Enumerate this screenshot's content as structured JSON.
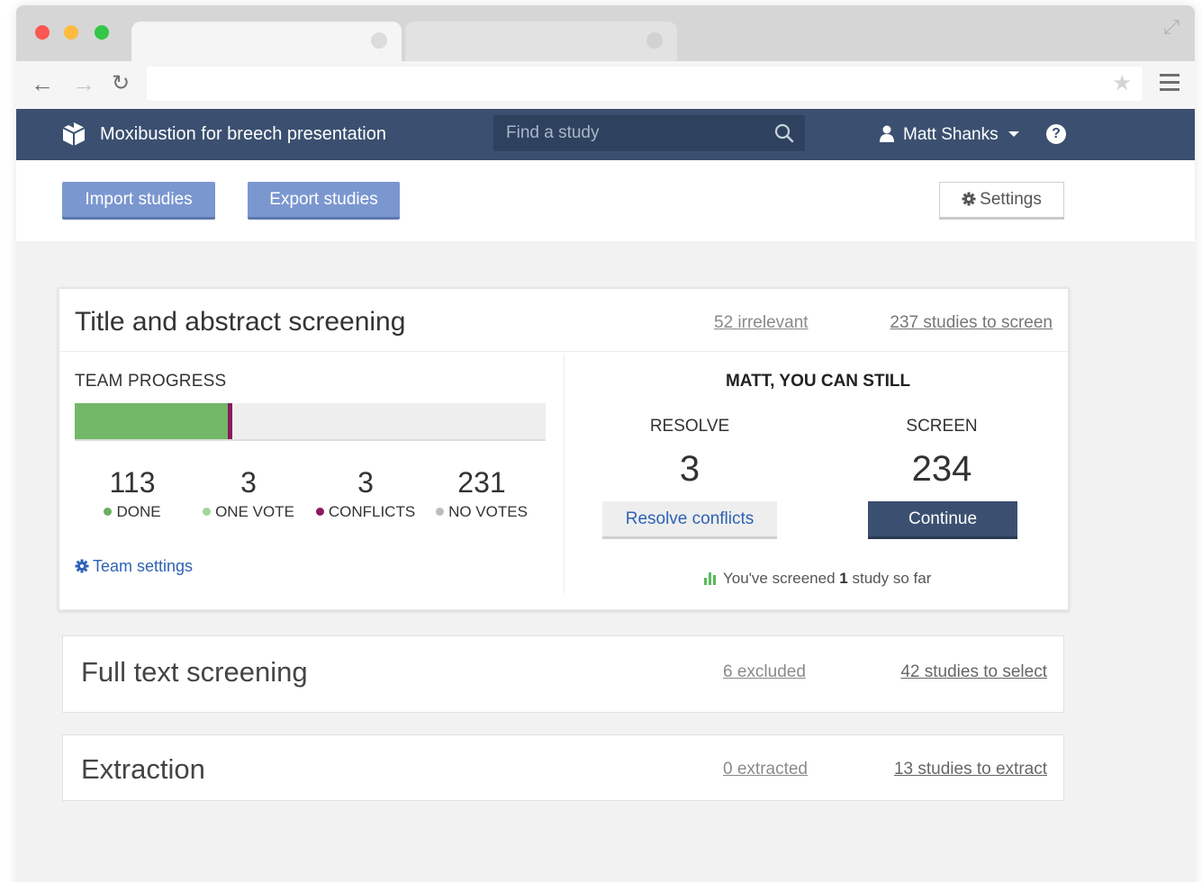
{
  "browser": {
    "address_value": ""
  },
  "app": {
    "project_title": "Moxibustion for breech presentation",
    "search_placeholder": "Find a study",
    "user_name": "Matt Shanks",
    "help_label": "?"
  },
  "actions": {
    "import_label": "Import studies",
    "export_label": "Export studies",
    "settings_label": "Settings"
  },
  "title_abstract": {
    "title": "Title and abstract screening",
    "irrelevant_link": "52 irrelevant",
    "to_screen_link": "237 studies to screen",
    "team_progress_label": "TEAM PROGRESS",
    "progress": {
      "done_fraction": 0.3256,
      "conflicts_fraction": 0.0086,
      "done_color": "#73b769",
      "conflict_color": "#8b1a5e"
    },
    "stats": [
      {
        "value": "113",
        "label": "DONE",
        "color": "#6aaf5e"
      },
      {
        "value": "3",
        "label": "ONE VOTE",
        "color": "#a6d49b"
      },
      {
        "value": "3",
        "label": "CONFLICTS",
        "color": "#8b1a5e"
      },
      {
        "value": "231",
        "label": "NO VOTES",
        "color": "#bdbdbd"
      }
    ],
    "team_settings_label": "Team settings",
    "you_can_still": "MATT, YOU CAN STILL",
    "resolve_label": "RESOLVE",
    "resolve_count": "3",
    "screen_label": "SCREEN",
    "screen_count": "234",
    "resolve_button": "Resolve conflicts",
    "continue_button": "Continue",
    "screened_prefix": "You've screened",
    "screened_count": "1",
    "screened_suffix": "study so far"
  },
  "full_text": {
    "title": "Full text screening",
    "excluded_link": "6 excluded",
    "to_select_link": "42 studies to select"
  },
  "extraction": {
    "title": "Extraction",
    "extracted_link": "0 extracted",
    "to_extract_link": "13 studies to extract"
  },
  "colors": {
    "header_bg": "#3b5070",
    "primary_button": "#7b97d0",
    "link_blue": "#2f62b5"
  }
}
